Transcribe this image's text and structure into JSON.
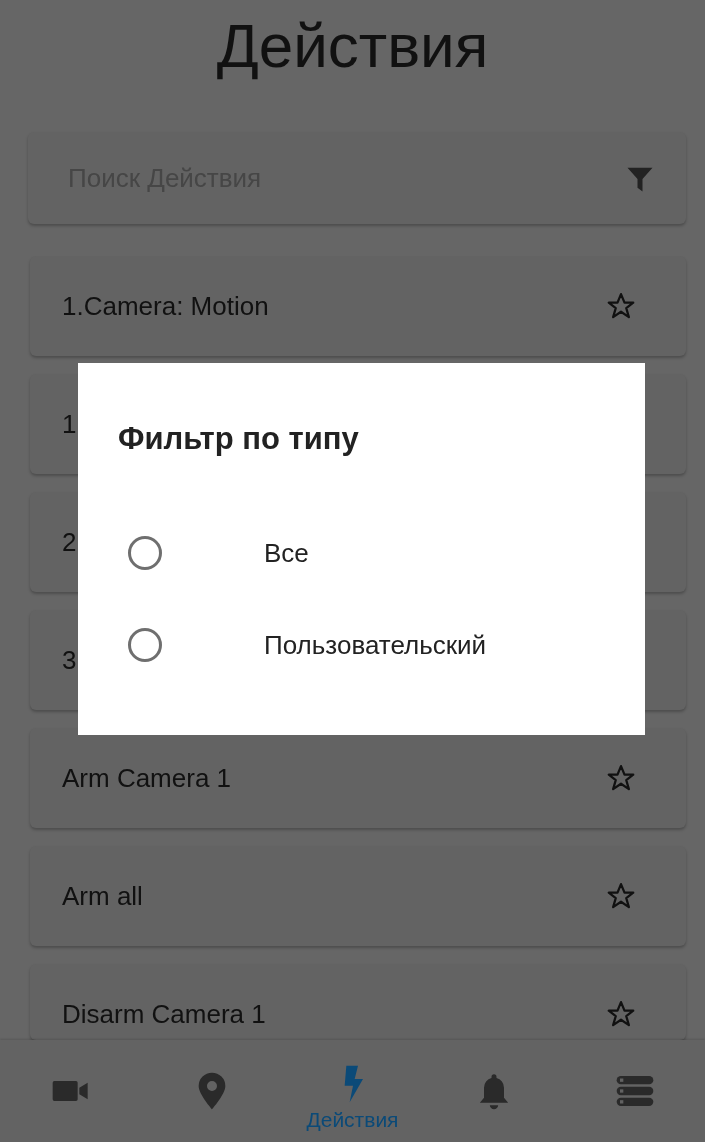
{
  "title": "Действия",
  "search": {
    "placeholder": "Поиск Действия"
  },
  "actions": [
    {
      "label": "1.Camera: Motion",
      "favorite": false
    },
    {
      "label": "1"
    },
    {
      "label": "2"
    },
    {
      "label": "3"
    },
    {
      "label": "Arm Camera 1",
      "favorite": false
    },
    {
      "label": "Arm all",
      "favorite": false
    },
    {
      "label": "Disarm Camera 1",
      "favorite": false
    }
  ],
  "dialog": {
    "title": "Фильтр по типу",
    "options": [
      {
        "label": "Все",
        "selected": false
      },
      {
        "label": "Пользовательский",
        "selected": false
      }
    ]
  },
  "bottom_nav": [
    {
      "kind": "camera",
      "selected": false
    },
    {
      "kind": "location",
      "selected": false
    },
    {
      "kind": "actions",
      "label": "Действия",
      "selected": true
    },
    {
      "kind": "bell",
      "selected": false
    },
    {
      "kind": "list",
      "selected": false
    }
  ]
}
